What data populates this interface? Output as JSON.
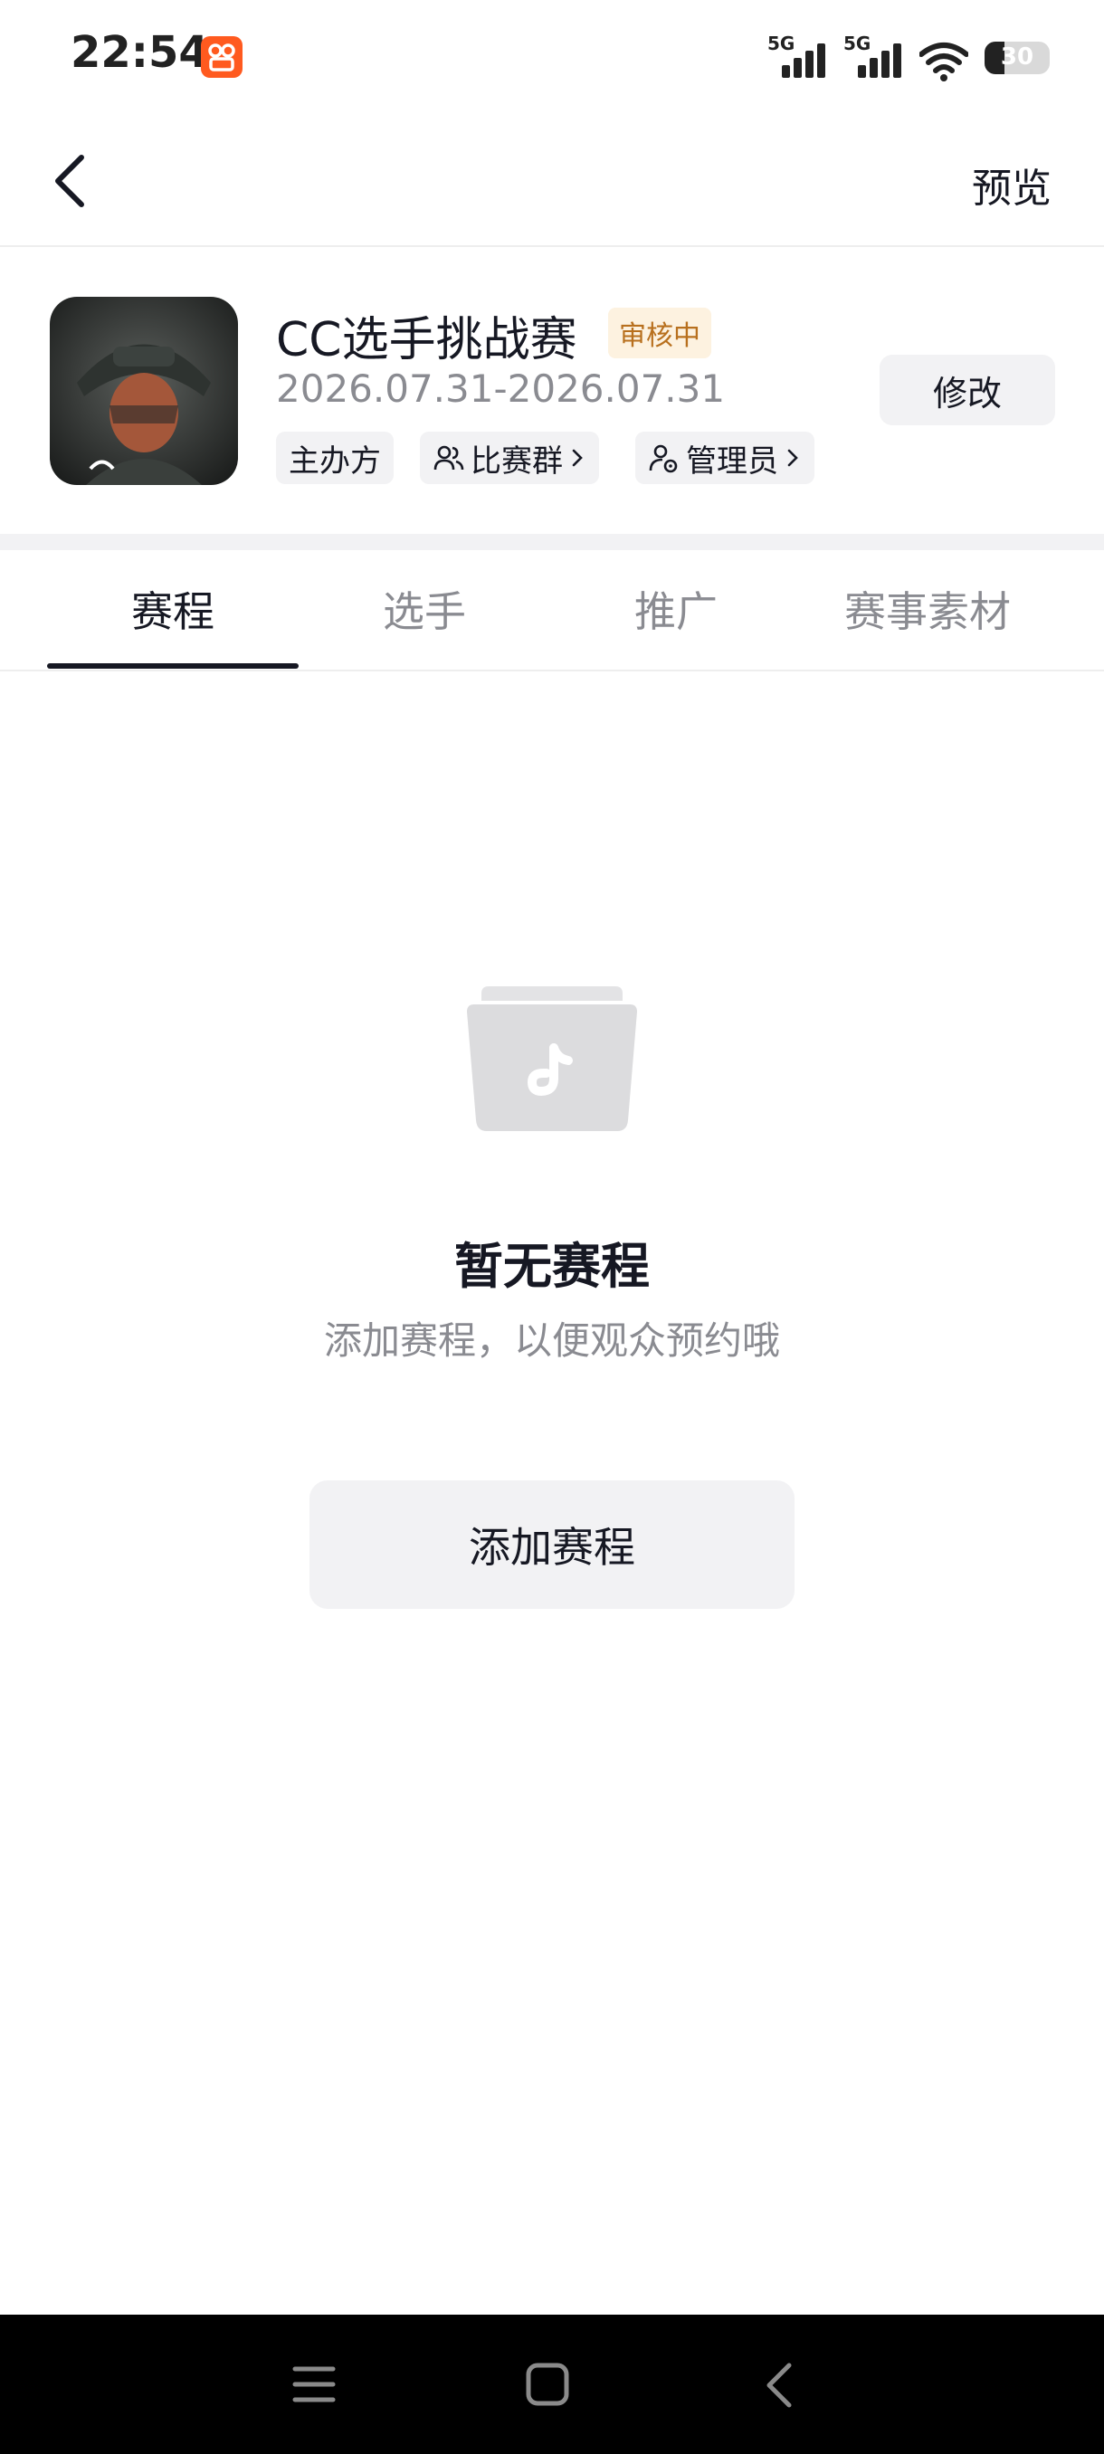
{
  "status_bar": {
    "time": "22:54",
    "network_1": "5G",
    "network_2": "5G",
    "battery": "30"
  },
  "header": {
    "back_icon": "chevron-left-icon",
    "preview_label": "预览"
  },
  "event": {
    "title": "CC选手挑战赛",
    "status_badge": "审核中",
    "dates": "2026.07.31-2026.07.31",
    "chips": {
      "organizer": "主办方",
      "group": "比赛群",
      "admin": "管理员"
    },
    "edit_label": "修改"
  },
  "tabs": [
    {
      "label": "赛程",
      "active": true
    },
    {
      "label": "选手",
      "active": false
    },
    {
      "label": "推广",
      "active": false
    },
    {
      "label": "赛事素材",
      "active": false
    }
  ],
  "empty_state": {
    "icon": "empty-folder-music-icon",
    "title": "暂无赛程",
    "subtitle": "添加赛程，以便观众预约哦",
    "button_label": "添加赛程"
  },
  "nav_bar": {
    "menu_icon": "menu-icon",
    "home_icon": "home-icon",
    "back_icon": "back-icon"
  },
  "colors": {
    "text_primary": "#161823",
    "text_secondary": "#8a8b91",
    "badge_bg": "#fdf2e0",
    "badge_text": "#b8701e",
    "button_bg": "#f2f2f4"
  }
}
